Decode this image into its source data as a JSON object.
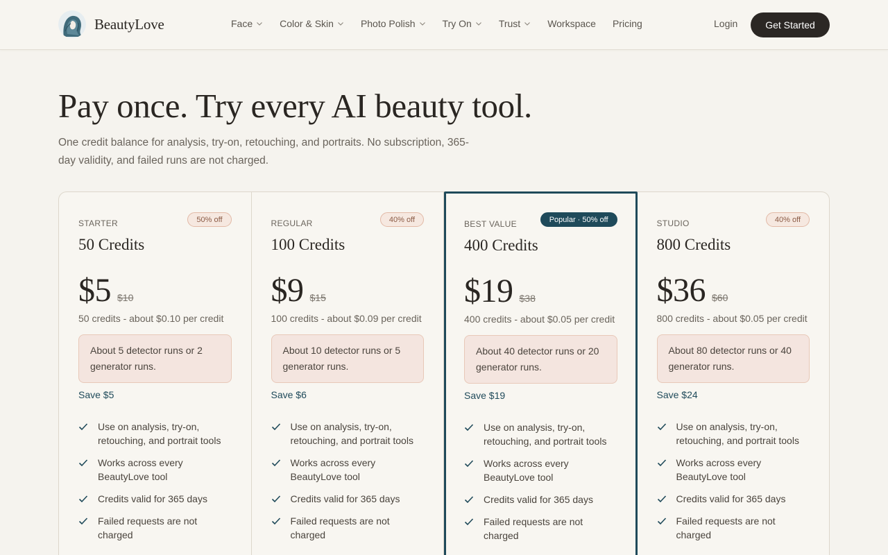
{
  "brand": {
    "name": "BeautyLove"
  },
  "nav": {
    "items": [
      {
        "label": "Face",
        "dropdown": true
      },
      {
        "label": "Color & Skin",
        "dropdown": true
      },
      {
        "label": "Photo Polish",
        "dropdown": true
      },
      {
        "label": "Try On",
        "dropdown": true
      },
      {
        "label": "Trust",
        "dropdown": true
      },
      {
        "label": "Workspace",
        "dropdown": false
      },
      {
        "label": "Pricing",
        "dropdown": false
      }
    ],
    "login_label": "Login",
    "cta_label": "Get Started"
  },
  "hero": {
    "title": "Pay once. Try every AI beauty tool.",
    "subtitle": "One credit balance for analysis, try-on, retouching, and portraits. No subscription, 365-day validity, and failed runs are not charged."
  },
  "plans": [
    {
      "tier": "STARTER",
      "badge": "50% off",
      "name": "50 Credits",
      "price": "$5",
      "original_price": "$10",
      "per_credit": "50 credits - about $0.10 per credit",
      "runs": "About 5 detector runs or 2 generator runs.",
      "savings": "Save $5",
      "featured": false,
      "features": [
        "Use on analysis, try-on, retouching, and portrait tools",
        "Works across every BeautyLove tool",
        "Credits valid for 365 days",
        "Failed requests are not charged"
      ]
    },
    {
      "tier": "REGULAR",
      "badge": "40% off",
      "name": "100 Credits",
      "price": "$9",
      "original_price": "$15",
      "per_credit": "100 credits - about $0.09 per credit",
      "runs": "About 10 detector runs or 5 generator runs.",
      "savings": "Save $6",
      "featured": false,
      "features": [
        "Use on analysis, try-on, retouching, and portrait tools",
        "Works across every BeautyLove tool",
        "Credits valid for 365 days",
        "Failed requests are not charged"
      ]
    },
    {
      "tier": "BEST VALUE",
      "badge": "Popular · 50% off",
      "name": "400 Credits",
      "price": "$19",
      "original_price": "$38",
      "per_credit": "400 credits - about $0.05 per credit",
      "runs": "About 40 detector runs or 20 generator runs.",
      "savings": "Save $19",
      "featured": true,
      "features": [
        "Use on analysis, try-on, retouching, and portrait tools",
        "Works across every BeautyLove tool",
        "Credits valid for 365 days",
        "Failed requests are not charged"
      ]
    },
    {
      "tier": "STUDIO",
      "badge": "40% off",
      "name": "800 Credits",
      "price": "$36",
      "original_price": "$60",
      "per_credit": "800 credits - about $0.05 per credit",
      "runs": "About 80 detector runs or 40 generator runs.",
      "savings": "Save $24",
      "featured": false,
      "features": [
        "Use on analysis, try-on, retouching, and portrait tools",
        "Works across every BeautyLove tool",
        "Credits valid for 365 days",
        "Failed requests are not charged"
      ]
    }
  ],
  "colors": {
    "background": "#f5f3ee",
    "accent": "#1f4a5a",
    "cta": "#2b2724",
    "badge_bg": "#f6e8e0"
  },
  "icons": {
    "logo": "woman-portrait-logo",
    "dropdown": "chevron-down-icon",
    "feature": "check-icon"
  }
}
